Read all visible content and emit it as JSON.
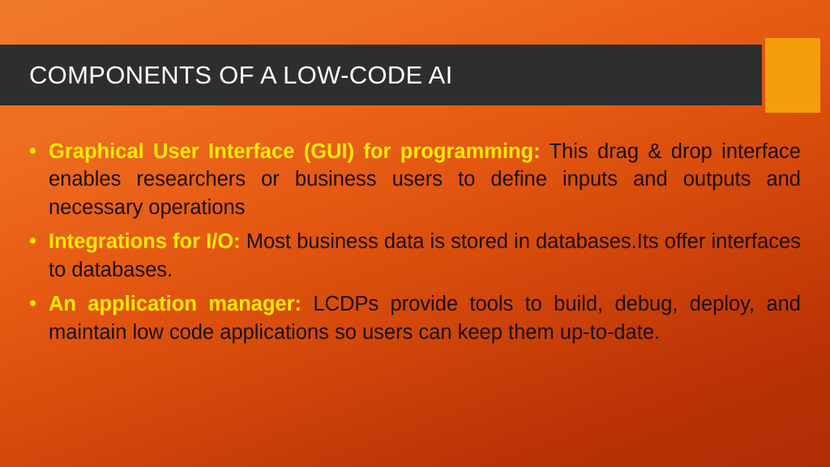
{
  "title": "COMPONENTS OF A LOW-CODE AI",
  "bullets": [
    {
      "heading": "Graphical User Interface (GUI) for programming:",
      "body": " This drag & drop interface enables researchers or business users to define inputs and outputs and necessary operations"
    },
    {
      "heading": "Integrations for I/O:",
      "body": " Most business data is stored in databases.Its offer interfaces to databases."
    },
    {
      "heading": "An application manager:",
      "body": " LCDPs provide tools to build, debug, deploy, and maintain low code applications so users can keep them up-to-date."
    }
  ]
}
